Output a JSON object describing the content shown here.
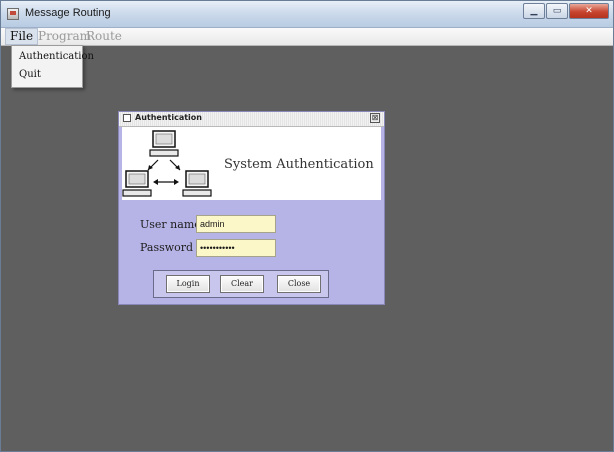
{
  "window": {
    "title": "Message Routing",
    "controls": {
      "minimize": "▁",
      "maximize": "▭",
      "close": "✕"
    }
  },
  "menubar": {
    "items": [
      "File",
      "Program",
      "Route"
    ],
    "open_menu": "File",
    "file_menu_items": [
      "Authentication",
      "Quit"
    ]
  },
  "dialog": {
    "title": "Authentication",
    "close_glyph": "⊠",
    "banner_title": "System Authentication",
    "banner_icon": "network-computers-icon",
    "username_label": "User name",
    "username_value": "admin",
    "password_label": "Password",
    "password_value": "•••••••••••",
    "buttons": {
      "login": "Login",
      "clear": "Clear",
      "close": "Close"
    }
  },
  "colors": {
    "desktop": "#5f5f5f",
    "dialog_body": "#b6b3e6",
    "field_background": "#fcf7c8"
  }
}
